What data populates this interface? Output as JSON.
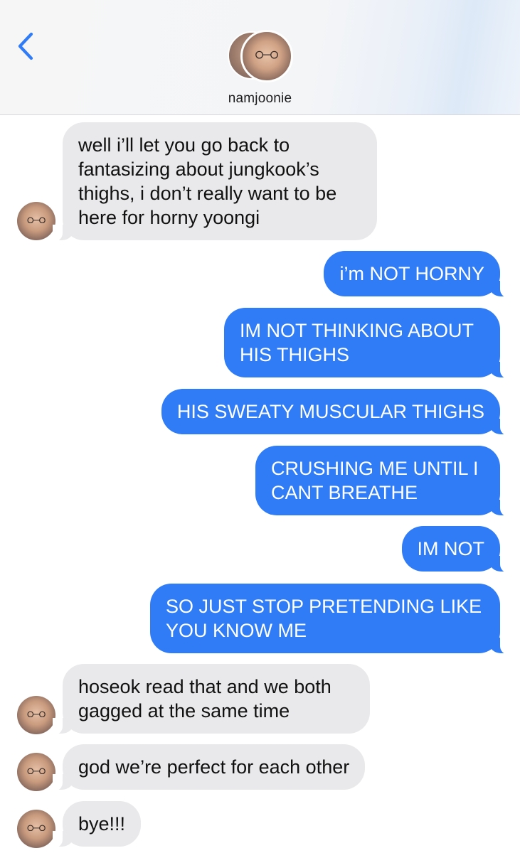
{
  "header": {
    "contact_name": "namjoonie",
    "back_icon": "chevron-left-icon",
    "accent_color": "#2f7cf6"
  },
  "messages": [
    {
      "direction": "incoming",
      "text": "well i’ll let you go back to fantasizing about jungkook’s thighs, i don’t really want to be here for horny yoongi"
    },
    {
      "direction": "outgoing",
      "text": "i’m NOT HORNY"
    },
    {
      "direction": "outgoing",
      "text": "IM NOT THINKING ABOUT HIS THIGHS"
    },
    {
      "direction": "outgoing",
      "text": "HIS SWEATY MUSCULAR THIGHS"
    },
    {
      "direction": "outgoing",
      "text": "CRUSHING ME UNTIL I CANT BREATHE"
    },
    {
      "direction": "outgoing",
      "text": "IM NOT"
    },
    {
      "direction": "outgoing",
      "text": "SO JUST STOP PRETENDING LIKE YOU KNOW ME"
    },
    {
      "direction": "incoming",
      "text": "hoseok read that and we both gagged at the same time"
    },
    {
      "direction": "incoming",
      "text": "god we’re perfect for each other"
    },
    {
      "direction": "incoming",
      "text": "bye!!!"
    }
  ]
}
